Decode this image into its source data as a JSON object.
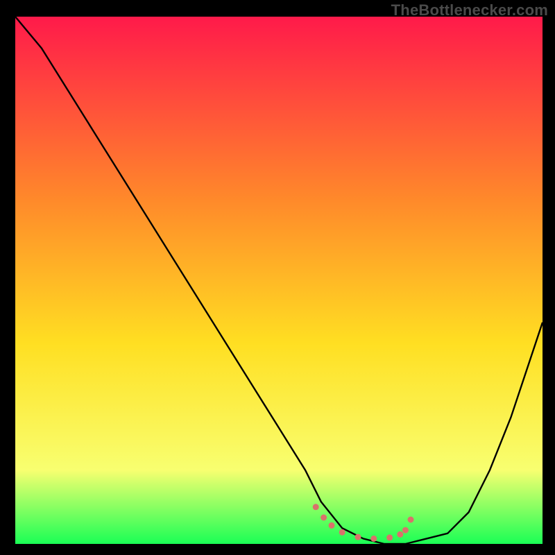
{
  "watermark": "TheBottlenecker.com",
  "gradient": {
    "top": "#ff1a4a",
    "mid1": "#ff6a2a",
    "mid2": "#ffdf22",
    "low": "#f8ff70",
    "bottom": "#1aff55"
  },
  "chart_data": {
    "type": "line",
    "title": "",
    "xlabel": "",
    "ylabel": "",
    "xlim": [
      0,
      100
    ],
    "ylim": [
      0,
      100
    ],
    "series": [
      {
        "name": "bottleneck-curve",
        "x": [
          0,
          5,
          10,
          15,
          20,
          25,
          30,
          35,
          40,
          45,
          50,
          55,
          58,
          62,
          66,
          70,
          74,
          78,
          82,
          86,
          90,
          94,
          98,
          100
        ],
        "y": [
          100,
          94,
          86,
          78,
          70,
          62,
          54,
          46,
          38,
          30,
          22,
          14,
          8,
          3,
          1,
          0,
          0,
          1,
          2,
          6,
          14,
          24,
          36,
          42
        ],
        "stroke": "#000000",
        "stroke_width": 2.4
      },
      {
        "name": "sweet-spot-marker",
        "x": [
          57,
          58.5,
          60,
          62,
          65,
          68,
          71,
          73,
          74,
          75
        ],
        "y": [
          7,
          5,
          3.5,
          2.2,
          1.3,
          1.0,
          1.2,
          1.8,
          2.6,
          4.6
        ],
        "stroke": "#d9726b",
        "stroke_width": 9,
        "dotted": true
      }
    ],
    "background_gradient": {
      "direction": "vertical",
      "stops": [
        {
          "offset": 0.0,
          "color": "#ff1a4a"
        },
        {
          "offset": 0.35,
          "color": "#ff8a2a"
        },
        {
          "offset": 0.62,
          "color": "#ffdf22"
        },
        {
          "offset": 0.86,
          "color": "#f8ff70"
        },
        {
          "offset": 1.0,
          "color": "#1aff55"
        }
      ]
    }
  }
}
